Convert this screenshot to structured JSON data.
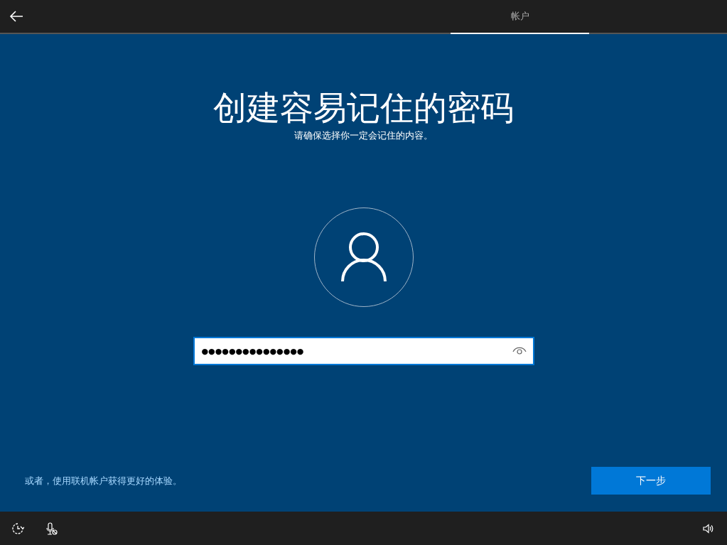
{
  "top_bar": {
    "tabs": [
      {
        "label": "帐户",
        "selected": true
      }
    ]
  },
  "title": "创建容易记住的密码",
  "subtitle": "请确保选择你一定会记住的内容。",
  "password_field": {
    "value": "●●●●●●●●●●●●●●●"
  },
  "online_account_link": "或者，使用联机帐户获得更好的体验。",
  "next_button": "下一步"
}
